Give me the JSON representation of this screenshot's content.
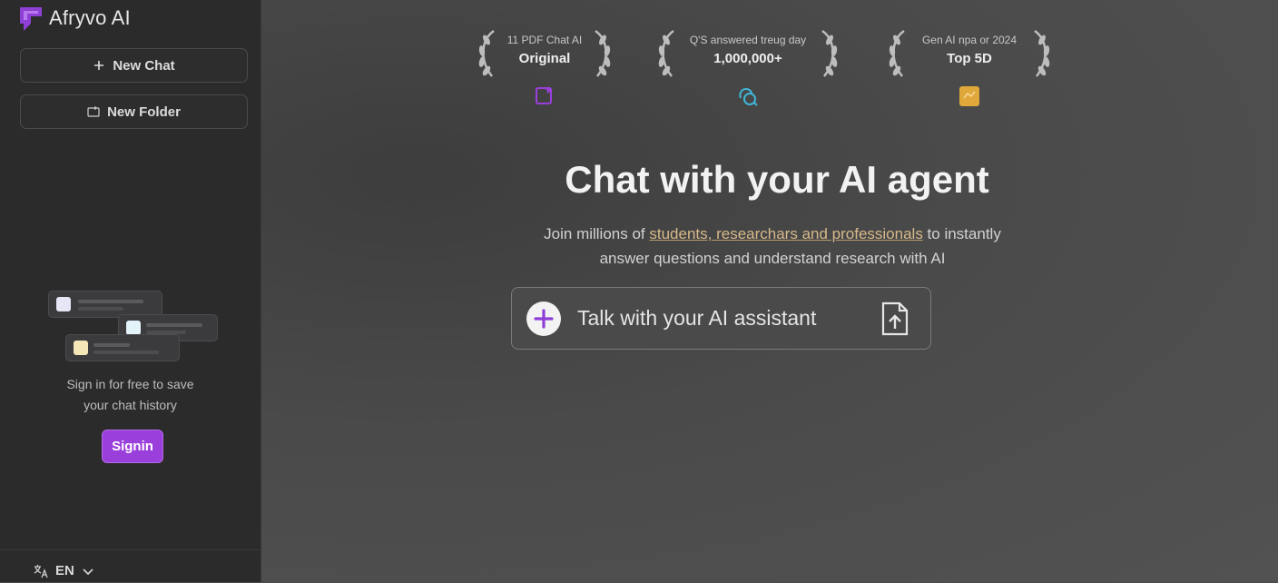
{
  "app": {
    "name": "Afryvo AI"
  },
  "sidebar": {
    "new_chat_label": "New Chat",
    "new_folder_label": "New Folder",
    "signin_prompt_line1": "Sign in for free to save",
    "signin_prompt_line2": "your chat history",
    "signin_button_label": "Signin",
    "language": "EN"
  },
  "badges": [
    {
      "label": "11 PDF Chat AI",
      "value": "Original",
      "icon": "document-star-icon",
      "icon_color": "#9b3fdc"
    },
    {
      "label": "Q'S answered treug day",
      "value": "1,000,000+",
      "icon": "chat-bubbles-icon",
      "icon_color": "#3fb6d9"
    },
    {
      "label": "Gen AI npa or 2024",
      "value": "Top 5D",
      "icon": "trophy-card-icon",
      "icon_color": "#e0a83a"
    }
  ],
  "main": {
    "headline": "Chat with your AI agent",
    "sub_prefix": "Join millions of ",
    "sub_highlight": "students, researchars and professionals",
    "sub_suffix": " to instantly",
    "sub_line2": "answer questions and understand research with AI",
    "input_placeholder": "Talk with your AI assistant"
  },
  "colors": {
    "accent": "#9b3fdc",
    "sidebar_bg": "#2b2b2c",
    "main_bg": "#4a4a4a",
    "highlight": "#d7b98a"
  }
}
